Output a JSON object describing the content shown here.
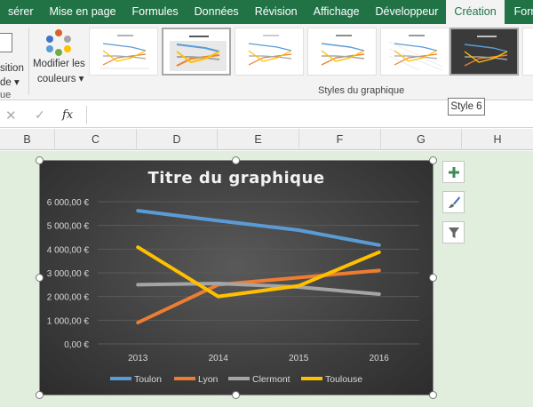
{
  "tabs": [
    "sérer",
    "Mise en page",
    "Formules",
    "Données",
    "Révision",
    "Affichage",
    "Développeur",
    "Création",
    "Format"
  ],
  "active_tab": "Création",
  "ribbon": {
    "layout_group": {
      "line1": "sition",
      "line2": "de ▾",
      "group_label": "ue"
    },
    "colors_button": {
      "line1": "Modifier les",
      "line2": "couleurs ▾"
    },
    "styles_group_label": "Styles du graphique",
    "palette_colors": [
      "#d9632b",
      "#4472c4",
      "#a5a5a5",
      "#5b9bd5",
      "#ffc000",
      "#70ad47"
    ],
    "tooltip": "Style 6"
  },
  "formula_bar": {
    "cancel": "✕",
    "enter": "✓",
    "fx": "fx",
    "value": ""
  },
  "columns": [
    "B",
    "C",
    "D",
    "E",
    "F",
    "G",
    "H"
  ],
  "chart_data": {
    "type": "line",
    "title": "Titre du graphique",
    "categories": [
      "2013",
      "2014",
      "2015",
      "2016"
    ],
    "y_tick_labels": [
      "0,00 €",
      "1 000,00 €",
      "2 000,00 €",
      "3 000,00 €",
      "4 000,00 €",
      "5 000,00 €",
      "6 000,00 €"
    ],
    "ylim": [
      0,
      6000
    ],
    "grid": true,
    "legend_position": "bottom",
    "series": [
      {
        "name": "Toulon",
        "color": "#5b9bd5",
        "values": [
          5620,
          5200,
          4800,
          4170
        ]
      },
      {
        "name": "Lyon",
        "color": "#ed7d31",
        "values": [
          900,
          2500,
          2800,
          3100
        ]
      },
      {
        "name": "Clermont",
        "color": "#a5a5a5",
        "values": [
          2500,
          2550,
          2400,
          2100
        ]
      },
      {
        "name": "Toulouse",
        "color": "#ffc000",
        "values": [
          4080,
          2000,
          2450,
          3870
        ]
      }
    ]
  },
  "side_buttons": [
    "chart-elements",
    "chart-styles",
    "chart-filters"
  ]
}
